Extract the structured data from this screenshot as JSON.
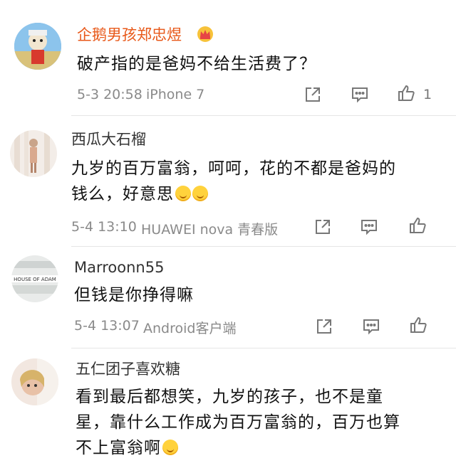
{
  "comments": [
    {
      "username": "企鹅男孩郑忠煜",
      "vip": true,
      "text": "破产指的是爸妈不给生活费了？",
      "time": "5-3 20:58",
      "device": "iPhone 7",
      "likes": "1"
    },
    {
      "username": "西瓜大石榴",
      "vip": false,
      "text_line1": "九岁的百万富翁，呵呵，花的不都是爸妈的",
      "text_line2": "钱么，好意思",
      "time": "5-4 13:10",
      "device": "HUAWEI nova 青春版"
    },
    {
      "username": "Marroonn55",
      "vip": false,
      "avatar_text": "HOUSE OF ADAM",
      "text": "但钱是你挣得嘛",
      "time": "5-4 13:07",
      "device": "Android客户端"
    },
    {
      "username": "五仁团子喜欢糖",
      "vip": false,
      "text_line1": "看到最后都想笑，九岁的孩子，也不是童",
      "text_line2": "星，靠什么工作成为百万富翁的，百万也算",
      "text_line3": "不上富翁啊"
    }
  ],
  "colors": {
    "vip_name": "#e8591a",
    "meta": "#8a8a8a",
    "divider": "#e6e6e6"
  },
  "icons": [
    "crown-icon",
    "share-icon",
    "comment-icon",
    "like-icon",
    "emoji-icon"
  ]
}
